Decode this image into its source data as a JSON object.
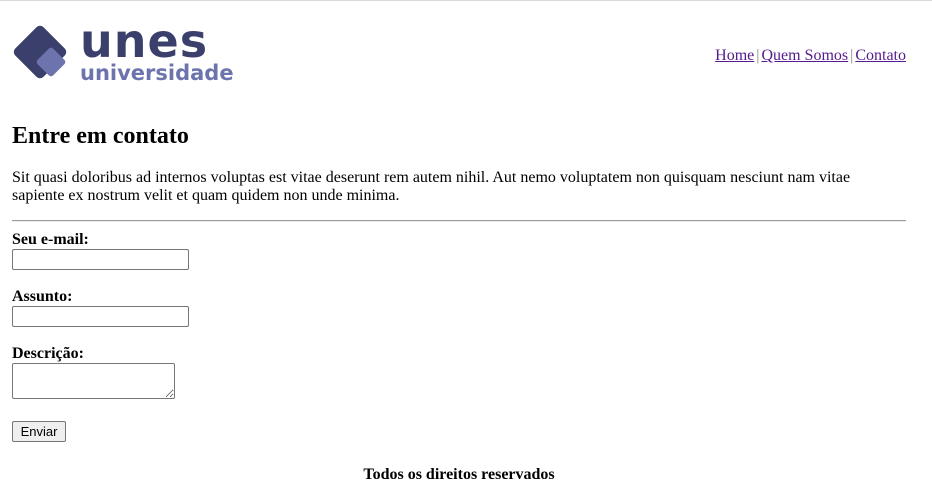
{
  "brand": {
    "name": "unes",
    "subtitle": "universidade",
    "colors": {
      "dark": "#3a3f6b",
      "light": "#6d74ad"
    }
  },
  "nav": {
    "items": [
      {
        "label": "Home"
      },
      {
        "label": "Quem Somos"
      },
      {
        "label": "Contato"
      }
    ],
    "separator": "|",
    "link_color": "#551a8b"
  },
  "main": {
    "title": "Entre em contato",
    "intro": "Sit quasi doloribus ad internos voluptas est vitae deserunt rem autem nihil. Aut nemo voluptatem non quisquam nesciunt nam vitae sapiente ex nostrum velit et quam quidem non unde minima."
  },
  "form": {
    "email": {
      "label": "Seu e-mail:",
      "value": "",
      "placeholder": ""
    },
    "subject": {
      "label": "Assunto:",
      "value": "",
      "placeholder": ""
    },
    "description": {
      "label": "Descrição:",
      "value": "",
      "placeholder": ""
    },
    "submit_label": "Enviar"
  },
  "footer": {
    "text": "Todos os direitos reservados"
  }
}
